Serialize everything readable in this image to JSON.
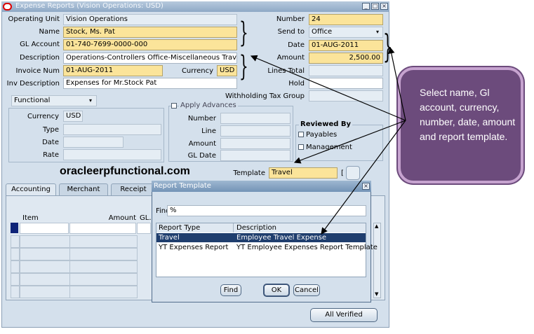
{
  "window": {
    "title": "Expense Reports (Vision Operations: USD)"
  },
  "header": {
    "operating_unit_label": "Operating Unit",
    "operating_unit_value": "Vision Operations",
    "name_label": "Name",
    "name_value": "Stock, Ms. Pat",
    "gl_account_label": "GL Account",
    "gl_account_value": "01-740-7699-0000-000",
    "description_label": "Description",
    "description_value": "Operations-Controllers Office-Miscellaneous Travel Expe-I",
    "invoice_num_label": "Invoice Num",
    "invoice_num_value": "01-AUG-2011",
    "currency_label": "Currency",
    "currency_value": "USD",
    "inv_description_label": "Inv Description",
    "inv_description_value": "Expenses for Mr.Stock Pat",
    "number_label": "Number",
    "number_value": "24",
    "send_to_label": "Send to",
    "send_to_value": "Office",
    "date_label": "Date",
    "date_value": "01-AUG-2011",
    "amount_label": "Amount",
    "amount_value": "2,500.00",
    "lines_total_label": "Lines Total",
    "hold_label": "Hold",
    "withholding_label": "Withholding Tax Group"
  },
  "functional": {
    "select_value": "Functional",
    "currency_label": "Currency",
    "currency_value": "USD",
    "type_label": "Type",
    "date_label": "Date",
    "rate_label": "Rate"
  },
  "advances": {
    "apply_label": "Apply Advances",
    "number_label": "Number",
    "line_label": "Line",
    "amount_label": "Amount",
    "gl_date_label": "GL Date"
  },
  "reviewed": {
    "title": "Reviewed By",
    "payables_label": "Payables",
    "management_label": "Management"
  },
  "template": {
    "label": "Template",
    "value": "Travel"
  },
  "tabs": [
    {
      "label": "Accounting"
    },
    {
      "label": "Merchant"
    },
    {
      "label": "Receipt"
    }
  ],
  "lines": {
    "item_header": "Item",
    "amount_header": "Amount",
    "gl_header": "GL."
  },
  "all_verified_button": "All Verified",
  "dialog": {
    "title": "Report Template",
    "find_label": "Find",
    "find_value": "%",
    "col_report_type": "Report Type",
    "col_description": "Description",
    "rows": [
      {
        "type": "Travel",
        "description": "Employee Travel Expense"
      },
      {
        "type": "YT Expenses Report",
        "description": "YT Employee Expenses Report Template"
      }
    ],
    "find_button": "Find",
    "ok_button": "OK",
    "cancel_button": "Cancel"
  },
  "watermark": "oracleerpfunctional.com",
  "callout": "Select name, Gl account, currency, number, date, amount and report template.",
  "colors": {
    "window_bg": "#d4e0ec",
    "required_field": "#fbe49a",
    "selected_row": "#1f3e6e",
    "callout_bg": "#6c4b7c",
    "callout_border": "#c6a3cf"
  }
}
